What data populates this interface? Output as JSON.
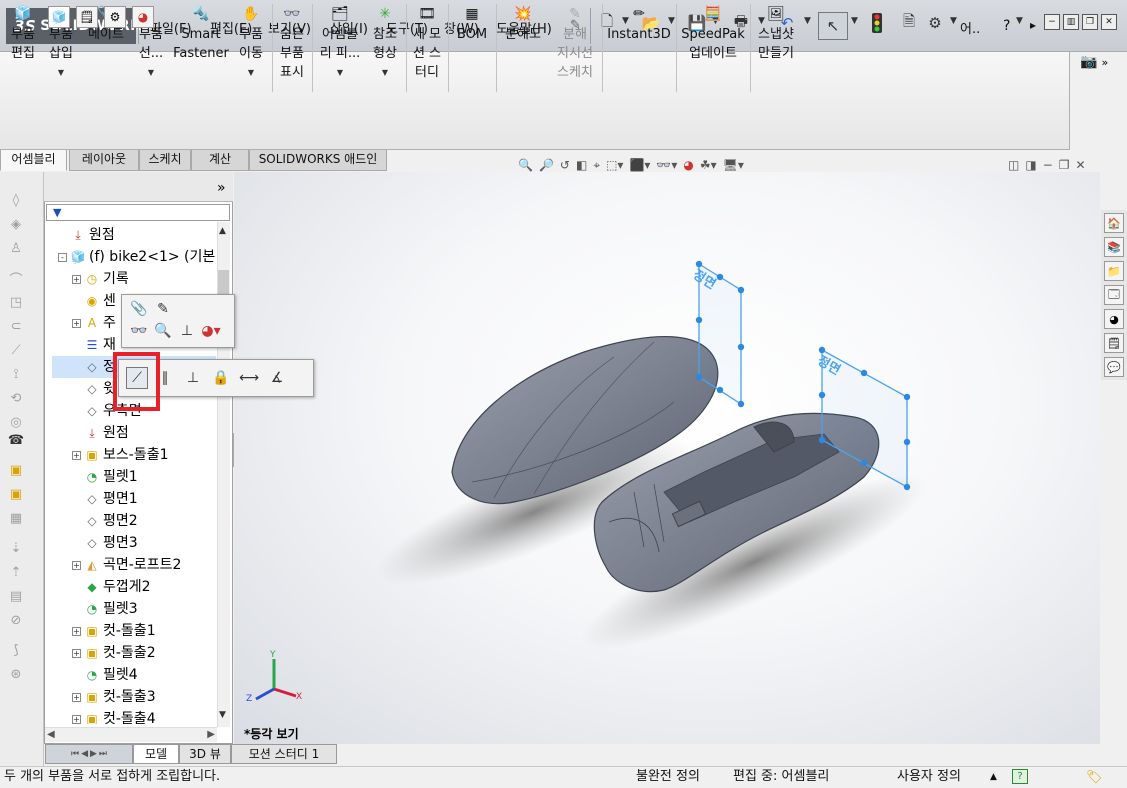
{
  "app": {
    "brand_prefix": "3S",
    "brand": "SOLIDWORKS"
  },
  "menu": [
    "파일(F)",
    "편집(E)",
    "보기(V)",
    "삽입(I)",
    "도구(T)",
    "창(W)",
    "도움말(H)"
  ],
  "titlebar_right": {
    "search_text": "어..",
    "help": "?"
  },
  "toolbar": {
    "commands": [
      {
        "label": "부품\n편집",
        "icon": "edit-component-icon"
      },
      {
        "label": "부품\n삽입",
        "icon": "insert-component-icon"
      },
      {
        "label": "메이트",
        "icon": "mate-icon"
      },
      {
        "label": "부품\n선...",
        "icon": "component-pattern-icon"
      },
      {
        "label": "Smart\nFastener",
        "icon": "smart-fastener-icon"
      },
      {
        "label": "부품\n이동",
        "icon": "move-component-icon"
      },
      {
        "label": "숨은\n부품\n표시",
        "icon": "show-hidden-icon"
      },
      {
        "label": "어셈블\n리 피...",
        "icon": "assembly-feature-icon"
      },
      {
        "label": "참조\n형상",
        "icon": "reference-geometry-icon"
      },
      {
        "label": "새 모\n션 스\n터디",
        "icon": "motion-study-icon"
      },
      {
        "label": "BOM",
        "icon": "bom-icon"
      },
      {
        "label": "분해도",
        "icon": "exploded-view-icon"
      },
      {
        "label": "분해\n지시선\n스케치",
        "icon": "explode-line-icon"
      },
      {
        "label": "Instant3D",
        "icon": "instant3d-icon"
      },
      {
        "label": "SpeedPak\n업데이트",
        "icon": "speedpak-icon"
      },
      {
        "label": "스냅샷\n만들기",
        "icon": "snapshot-icon"
      }
    ]
  },
  "tabs": [
    "어셈블리",
    "레이아웃",
    "스케치",
    "계산",
    "SOLIDWORKS 애드인"
  ],
  "feature_tree": {
    "items": [
      {
        "label": "원점",
        "icon": "origin-icon",
        "expand": ""
      },
      {
        "label": "(f) bike2<1> (기본-",
        "icon": "part-icon",
        "expand": "-"
      },
      {
        "label": "기록",
        "icon": "history-icon",
        "expand": "+"
      },
      {
        "label": "센",
        "icon": "sensor-icon",
        "expand": ""
      },
      {
        "label": "주",
        "icon": "annotations-icon",
        "expand": "+"
      },
      {
        "label": "재",
        "icon": "material-icon",
        "expand": ""
      },
      {
        "label": "정",
        "icon": "plane-icon",
        "expand": ""
      },
      {
        "label": "윗",
        "icon": "plane-icon",
        "expand": ""
      },
      {
        "label": "우측면",
        "icon": "plane-icon",
        "expand": ""
      },
      {
        "label": "원점",
        "icon": "origin-icon",
        "expand": ""
      },
      {
        "label": "보스-돌출1",
        "icon": "boss-extrude-icon",
        "expand": "+"
      },
      {
        "label": "필렛1",
        "icon": "fillet-icon",
        "expand": ""
      },
      {
        "label": "평면1",
        "icon": "plane-icon",
        "expand": ""
      },
      {
        "label": "평면2",
        "icon": "plane-icon",
        "expand": ""
      },
      {
        "label": "평면3",
        "icon": "plane-icon",
        "expand": ""
      },
      {
        "label": "곡면-로프트2",
        "icon": "surface-loft-icon",
        "expand": "+"
      },
      {
        "label": "두껍게2",
        "icon": "thicken-icon",
        "expand": ""
      },
      {
        "label": "필렛3",
        "icon": "fillet-icon",
        "expand": ""
      },
      {
        "label": "컷-돌출1",
        "icon": "cut-extrude-icon",
        "expand": "+"
      },
      {
        "label": "컷-돌출2",
        "icon": "cut-extrude-icon",
        "expand": "+"
      },
      {
        "label": "필렛4",
        "icon": "fillet-icon",
        "expand": ""
      },
      {
        "label": "컷-돌출3",
        "icon": "cut-extrude-icon",
        "expand": "+"
      },
      {
        "label": "컷-돌출4",
        "icon": "cut-extrude-icon",
        "expand": "+"
      }
    ]
  },
  "bottom_tabs": [
    "모델",
    "3D 뷰",
    "모션 스터디 1"
  ],
  "viewport": {
    "view_label": "*등각 보기",
    "plane_label": "정면",
    "axis_x": "X",
    "axis_y": "Y",
    "axis_z": "Z"
  },
  "status": {
    "message": "두 개의 부품을 서로 접하게 조립합니다.",
    "state": "불완전 정의",
    "editing": "편집 중: 어셈블리",
    "units": "사용자 정의",
    "units_arrow": "▲"
  },
  "colors": {
    "accent_red": "#e8202a",
    "plane_blue": "#4aa3f0",
    "body_gray": "#7c8290"
  }
}
